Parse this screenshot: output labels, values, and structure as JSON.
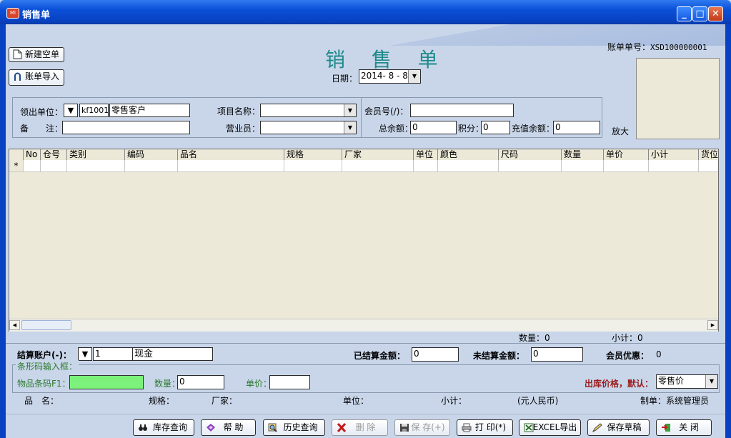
{
  "window": {
    "title": "销售单"
  },
  "toolbar": {
    "new_label": "新建空单",
    "import_label": "账单导入"
  },
  "header": {
    "title": "销 售 单",
    "date_label": "日期：",
    "date_value": "2014- 8 - 8",
    "bill_no_label": "账单单号：",
    "bill_no_value": "XSD100000001",
    "zoom_label": "放大"
  },
  "form": {
    "issuer_label": "领出单位：",
    "issuer_code": "kf1001",
    "issuer_name": "零售客户",
    "note_label": "备　　注：",
    "note_value": "",
    "project_label": "项目名称：",
    "project_value": "",
    "sales_label": "营业员：",
    "sales_value": "",
    "member_label": "会员号(/)：",
    "member_value": "",
    "balance_label": "总余额：",
    "balance_value": "0",
    "points_label": "积分：",
    "points_value": "0",
    "recharge_label": "充值余额：",
    "recharge_value": "0"
  },
  "grid": {
    "columns": [
      "No",
      "仓号",
      "类别",
      "编码",
      "品名",
      "规格",
      "厂家",
      "单位",
      "颜色",
      "尺码",
      "数量",
      "单价",
      "小计",
      "货位"
    ],
    "new_row_marker": "*",
    "qty_total_label": "数量：0",
    "subtotal_label": "小计：0"
  },
  "settlement": {
    "account_label": "结算账户(-)：",
    "account_code": "1",
    "account_name": "现金",
    "settled_label": "已结算金额：",
    "settled_value": "0",
    "unsettled_label": "未结算金额：",
    "unsettled_value": "0",
    "member_discount_label": "会员优惠：",
    "member_discount_value": "0"
  },
  "barcode": {
    "group_label": "条形码输入框：",
    "barcode_label": "物品条码F1：",
    "barcode_value": "",
    "qty_label": "数量：",
    "qty_value": "0",
    "price_label": "单价：",
    "price_value": "",
    "out_price_label": "出库价格，默认：",
    "out_price_value": "零售价"
  },
  "info": {
    "name_label": "品　名：",
    "spec_label": "规格：",
    "maker_label": "厂家：",
    "unit_label": "单位：",
    "subtotal_label": "小计：",
    "currency_label": "(元人民币)",
    "maker_by_label": "制单：系统管理员"
  },
  "buttons": {
    "stock_query": "库存查询",
    "help": "帮 助",
    "history": "历史查询",
    "delete": "删 除",
    "save": "保 存(+)",
    "print": "打 印(*)",
    "excel": "EXCEL导出",
    "draft": "保存草稿",
    "close": "关 闭"
  },
  "colors": {
    "title_teal": "#1e8a8a",
    "barcode_green": "#7cf27c",
    "label_red": "#9b1b1b",
    "xp_blue": "#0842c2"
  }
}
